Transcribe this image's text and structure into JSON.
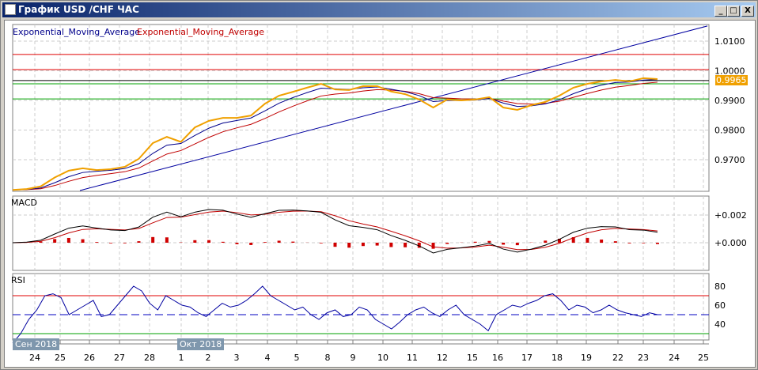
{
  "window": {
    "title": "График USD /CHF  ЧАС",
    "minimize": "_",
    "maximize": "□",
    "close": "X"
  },
  "legend": {
    "ema1": "Exponential_Moving_Average",
    "ema2": "Exponential_Moving_Average",
    "ema1_color": "#00008b",
    "ema2_color": "#c00000"
  },
  "macd_label": "MACD",
  "rsi_label": "RSI",
  "price_tag": "0.9965",
  "month_labels": [
    "Сен 2018",
    "Окт 2018"
  ],
  "chart_data": [
    {
      "type": "line",
      "title": "USD/CHF hourly",
      "ylim": [
        0.9575,
        1.0155
      ],
      "yticks": [
        "1.0100",
        "1.0000",
        "0.9900",
        "0.9800",
        "0.9700"
      ],
      "ytick_values": [
        1.01,
        1.0,
        0.99,
        0.98,
        0.97
      ],
      "xticks": [
        "24",
        "25",
        "26",
        "27",
        "28",
        "1",
        "2",
        "3",
        "4",
        "5",
        "8",
        "9",
        "10",
        "11",
        "12",
        "15",
        "16",
        "17",
        "18",
        "19",
        "22",
        "23",
        "24",
        "25"
      ],
      "price": [
        0.9598,
        0.9601,
        0.961,
        0.964,
        0.9663,
        0.9671,
        0.9665,
        0.9668,
        0.9676,
        0.9703,
        0.9756,
        0.9777,
        0.976,
        0.9809,
        0.9831,
        0.9841,
        0.9841,
        0.9849,
        0.9889,
        0.9916,
        0.9929,
        0.9943,
        0.9956,
        0.9937,
        0.9935,
        0.9948,
        0.9948,
        0.993,
        0.9921,
        0.9903,
        0.9876,
        0.9903,
        0.99,
        0.9903,
        0.9911,
        0.9876,
        0.9868,
        0.9884,
        0.9895,
        0.9916,
        0.9943,
        0.9956,
        0.9964,
        0.9969,
        0.9964,
        0.9975,
        0.9972
      ],
      "horizontal_lines": [
        {
          "value": 1.0055,
          "color": "#e00000"
        },
        {
          "value": 1.0004,
          "color": "#e00000"
        },
        {
          "value": 0.9967,
          "color": "#000000"
        },
        {
          "value": 0.9956,
          "color": "#00a000"
        },
        {
          "value": 0.9905,
          "color": "#00a000"
        }
      ],
      "trendline": {
        "from": 0.9596,
        "to": 1.0151,
        "color": "#0000a0"
      },
      "price_color": "#f0a000"
    },
    {
      "type": "line",
      "title": "MACD",
      "ylim": [
        -0.0009,
        0.003
      ],
      "yticks": [
        "+0.002",
        "+0.000"
      ],
      "ytick_values": [
        0.002,
        0.0
      ]
    },
    {
      "type": "line",
      "title": "RSI",
      "ylim": [
        20,
        90
      ],
      "yticks": [
        "80",
        "60",
        "40"
      ],
      "ytick_values": [
        80,
        60,
        40
      ],
      "levels": [
        70,
        50,
        30
      ],
      "values": [
        20,
        30,
        45,
        55,
        70,
        72,
        68,
        50,
        55,
        60,
        65,
        48,
        50,
        60,
        70,
        80,
        75,
        62,
        55,
        70,
        65,
        60,
        58,
        52,
        48,
        55,
        62,
        58,
        60,
        65,
        72,
        80,
        70,
        65,
        60,
        55,
        58,
        50,
        45,
        52,
        55,
        48,
        50,
        58,
        55,
        45,
        40,
        35,
        42,
        50,
        55,
        58,
        52,
        48,
        55,
        60,
        50,
        45,
        40,
        33,
        50,
        55,
        60,
        58,
        62,
        65,
        70,
        72,
        65,
        55,
        60,
        58,
        52,
        55,
        60,
        55,
        52,
        50,
        48,
        52,
        50
      ]
    }
  ]
}
